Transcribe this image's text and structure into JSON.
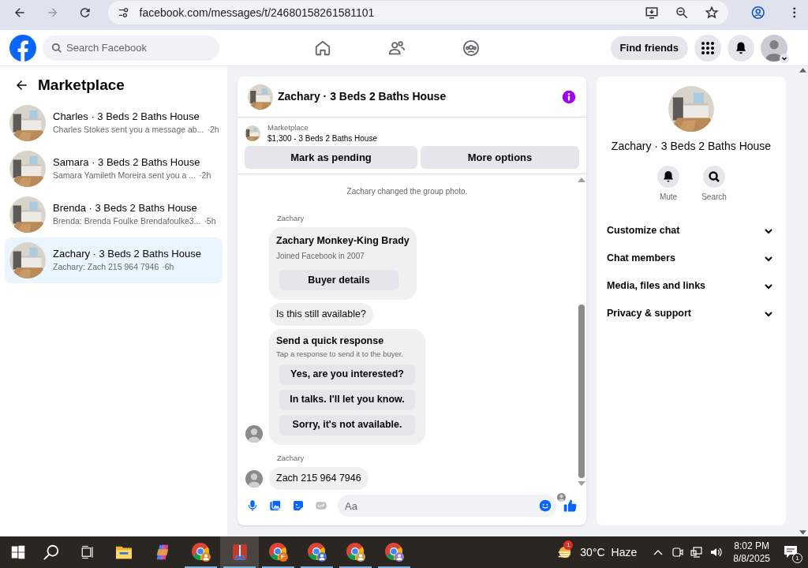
{
  "browser": {
    "url": "facebook.com/messages/t/24680158261581101"
  },
  "header": {
    "search_placeholder": "Search Facebook",
    "find_friends": "Find friends"
  },
  "sidebar": {
    "title": "Marketplace",
    "conversations": [
      {
        "title": "Charles · 3 Beds 2 Baths House",
        "preview": "Charles Stokes sent you a message ab...",
        "time": "·2h",
        "selected": false
      },
      {
        "title": "Samara · 3 Beds 2 Baths House",
        "preview": "Samara Yamileth Moreira sent you a ...",
        "time": "·2h",
        "selected": false
      },
      {
        "title": "Brenda · 3 Beds 2 Baths House",
        "preview": "Brenda: Brenda Foulke Brendafoulke3...",
        "time": "·5h",
        "selected": false
      },
      {
        "title": "Zachary · 3 Beds 2 Baths House",
        "preview": "Zachary: Zach 215 964 7946",
        "time": "·6h",
        "selected": true
      }
    ]
  },
  "chat": {
    "title": "Zachary · 3 Beds 2 Baths House",
    "listing": {
      "label": "Marketplace",
      "title": "$1,300 - 3 Beds 2 Baths House"
    },
    "actions": [
      "Mark as pending",
      "More options"
    ],
    "messages": [
      {
        "kind": "system",
        "text": "Zachary changed the group photo."
      },
      {
        "kind": "sender",
        "text": "Zachary"
      },
      {
        "kind": "buyer_card",
        "name": "Zachary Monkey-King Brady",
        "subtitle": "Joined Facebook in 2007",
        "button": "Buyer details",
        "avatar": false
      },
      {
        "kind": "text",
        "text": "Is this still available?",
        "avatar": false
      },
      {
        "kind": "quick_responses",
        "title": "Send a quick response",
        "subtitle": "Tap a response to send it to the buyer.",
        "options": [
          "Yes, are you interested?",
          "In talks. I'll let you know.",
          "Sorry, it's not available."
        ],
        "avatar": true
      },
      {
        "kind": "sender",
        "text": "Zachary"
      },
      {
        "kind": "text",
        "text": "Zach 215 964 7946",
        "avatar": true
      }
    ],
    "composer_placeholder": "Aa"
  },
  "details": {
    "title": "Zachary · 3 Beds 2 Baths House",
    "actions": [
      {
        "kind": "mute",
        "label": "Mute"
      },
      {
        "kind": "search",
        "label": "Search"
      }
    ],
    "sections": [
      {
        "label": "Customize chat",
        "expanded": false
      },
      {
        "label": "Chat members",
        "expanded": false
      },
      {
        "label": "Media, files and links",
        "expanded": false
      },
      {
        "label": "Privacy & support",
        "expanded": false
      }
    ]
  },
  "taskbar": {
    "apps": [
      {
        "kind": "explorer",
        "active": false,
        "running": false
      },
      {
        "kind": "copilot",
        "active": false,
        "running": false
      },
      {
        "kind": "chrome",
        "active": false,
        "running": true,
        "color": "#e08a2c"
      },
      {
        "kind": "tool",
        "active": true,
        "running": true
      },
      {
        "kind": "chrome",
        "active": false,
        "running": true,
        "color": "#e8711c",
        "badge": "F"
      },
      {
        "kind": "chrome",
        "active": false,
        "running": true,
        "color": "#4a78c8"
      },
      {
        "kind": "chrome",
        "active": false,
        "running": true,
        "color": "#c8a860"
      },
      {
        "kind": "chrome",
        "active": false,
        "running": true,
        "color": "#9a7ad0"
      }
    ],
    "weather": {
      "badge": "1",
      "temperature": "30°C",
      "condition": "Haze"
    },
    "time": "8:02 PM",
    "date": "8/8/2025",
    "notifications": "1"
  }
}
